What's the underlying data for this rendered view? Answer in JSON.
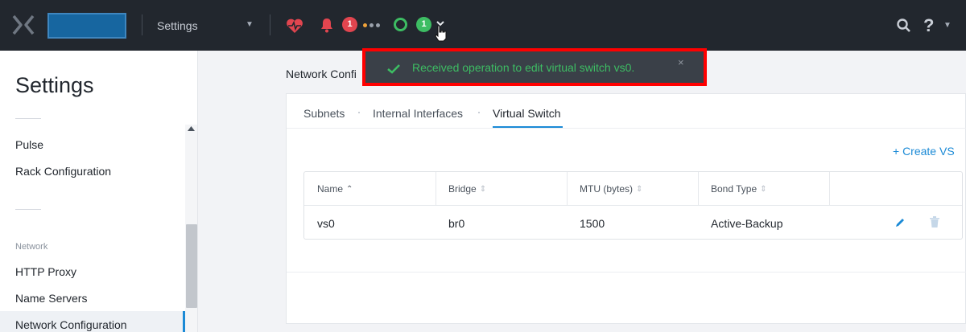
{
  "topbar": {
    "menu_label": "Settings",
    "alerts_count": "1",
    "tasks_count": "1",
    "help_label": "?",
    "colors": {
      "bar": "#22272e",
      "health": "#e2454f",
      "success": "#3dbd63",
      "warning": "#f0a33a"
    }
  },
  "sidebar": {
    "title": "Settings",
    "items_top": [
      "Pulse",
      "Rack Configuration"
    ],
    "section_network": "Network",
    "items_network": [
      "HTTP Proxy",
      "Name Servers",
      "Network Configuration"
    ]
  },
  "main": {
    "breadcrumb": "Network Confi",
    "tabs": [
      "Subnets",
      "Internal Interfaces",
      "Virtual Switch"
    ],
    "active_tab": "Virtual Switch",
    "create_button": "+  Create VS",
    "table": {
      "headers": [
        "Name",
        "Bridge",
        "MTU (bytes)",
        "Bond Type"
      ],
      "rows": [
        {
          "name": "vs0",
          "bridge": "br0",
          "mtu": "1500",
          "bond_type": "Active-Backup"
        }
      ]
    }
  },
  "toast": {
    "message": "Received operation to edit virtual switch vs0.",
    "close": "×"
  },
  "icons": {
    "logo": "nutanix-x-logo",
    "health": "heartbeat-icon",
    "alerts": "bell-icon",
    "search": "search-icon",
    "edit": "pencil-icon",
    "delete": "trash-icon"
  }
}
